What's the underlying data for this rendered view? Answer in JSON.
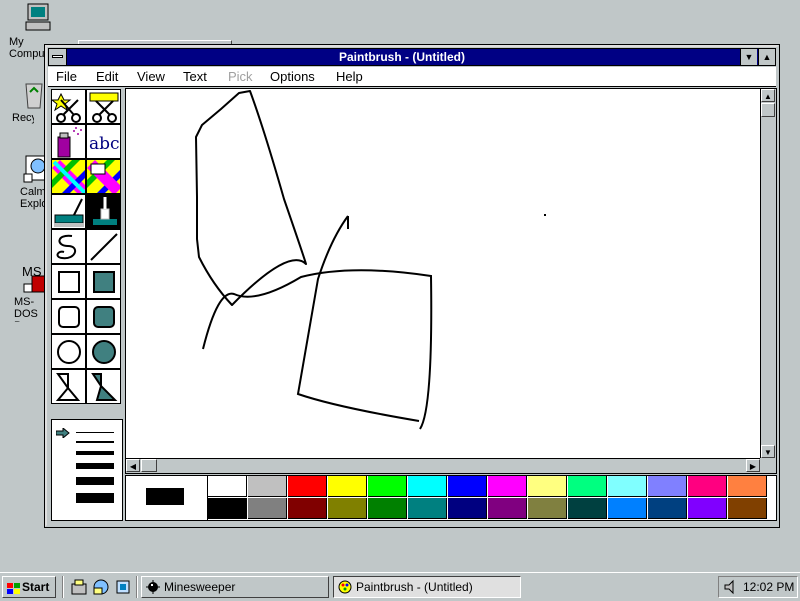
{
  "desktop": {
    "icons": [
      {
        "label": "My Computer",
        "icon": "computer-icon"
      },
      {
        "label": "Recycle Bin",
        "icon": "recycle-bin-icon"
      },
      {
        "label": "Calm Explorer",
        "icon": "explorer-icon"
      },
      {
        "label": "MS-DOS Prompt",
        "icon": "msdos-icon"
      }
    ]
  },
  "window": {
    "title": "Paintbrush - (Untitled)",
    "menu": [
      "File",
      "Edit",
      "View",
      "Text",
      "Pick",
      "Options",
      "Help"
    ]
  },
  "tools": {
    "text_tool_label": "abc",
    "items": [
      "scissors-free-select",
      "scissors-rect-select",
      "airbrush",
      "text",
      "color-eraser",
      "eraser",
      "paint-roller",
      "brush",
      "curve",
      "line",
      "box",
      "filled-box",
      "rounded-box",
      "filled-rounded-box",
      "circle",
      "filled-circle",
      "polygon",
      "filled-polygon"
    ]
  },
  "palette": {
    "foreground": "#000000",
    "background": "#ffffff",
    "top_row": [
      "#ffffff",
      "#c0c0c0",
      "#ff0000",
      "#ffff00",
      "#00ff00",
      "#00ffff",
      "#0000ff",
      "#ff00ff",
      "#ffff80",
      "#00ff80",
      "#80ffff",
      "#8080ff",
      "#ff0080",
      "#ff8040"
    ],
    "bottom_row": [
      "#000000",
      "#808080",
      "#800000",
      "#808000",
      "#008000",
      "#008080",
      "#000080",
      "#800080",
      "#808040",
      "#004040",
      "#0080ff",
      "#004080",
      "#8000ff",
      "#804000"
    ]
  },
  "taskbar": {
    "start_label": "Start",
    "tasks": [
      {
        "label": "Minesweeper",
        "active": false,
        "icon": "minesweeper-icon"
      },
      {
        "label": "Paintbrush - (Untitled)",
        "active": true,
        "icon": "paintbrush-icon"
      }
    ],
    "clock": "12:02 PM"
  }
}
